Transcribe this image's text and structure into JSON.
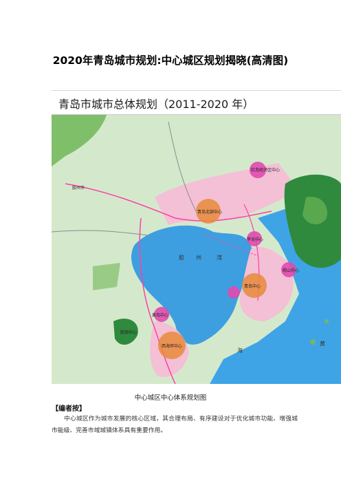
{
  "document": {
    "title": "2020年青岛城市规划:中心城区规划揭晓(高清图)",
    "figure_title": "青岛市城市总体规划（2011-2020 年）",
    "figure_caption": "中心城区中心体系规划图",
    "editor_note_label": "【编者按】",
    "paragraph": "中心城区作为城市发展的核心区域，其合理布局、有序建设对于优化城市功能、增强城市能级、完善市域城镇体系具有重要作用。"
  },
  "map": {
    "labels": {
      "city_west": "胶州市",
      "center_north": "青岛北部中心",
      "center_red_island": "红岛经济区中心",
      "center_licang": "李沧中心",
      "center_laoshan": "崂山中心",
      "center_huangdao": "黄岛中心",
      "center_main": "青岛中心",
      "center_west_coast": "西海岸中心",
      "center_left": "胶南中心",
      "bay_name_1": "胶",
      "bay_name_2": "州",
      "bay_name_3": "湾",
      "sea_1": "黄",
      "sea_2": "海"
    },
    "colors": {
      "water": "#3d9fe0",
      "sea": "#3fa4e6",
      "land": "#cfe8c6",
      "urban": "#f6c7d9",
      "forest": "#2f8a3e",
      "green": "#72b862",
      "road": "#ff3fa5",
      "center_orange": "#e8893a",
      "center_magenta": "#e04ab0"
    }
  }
}
